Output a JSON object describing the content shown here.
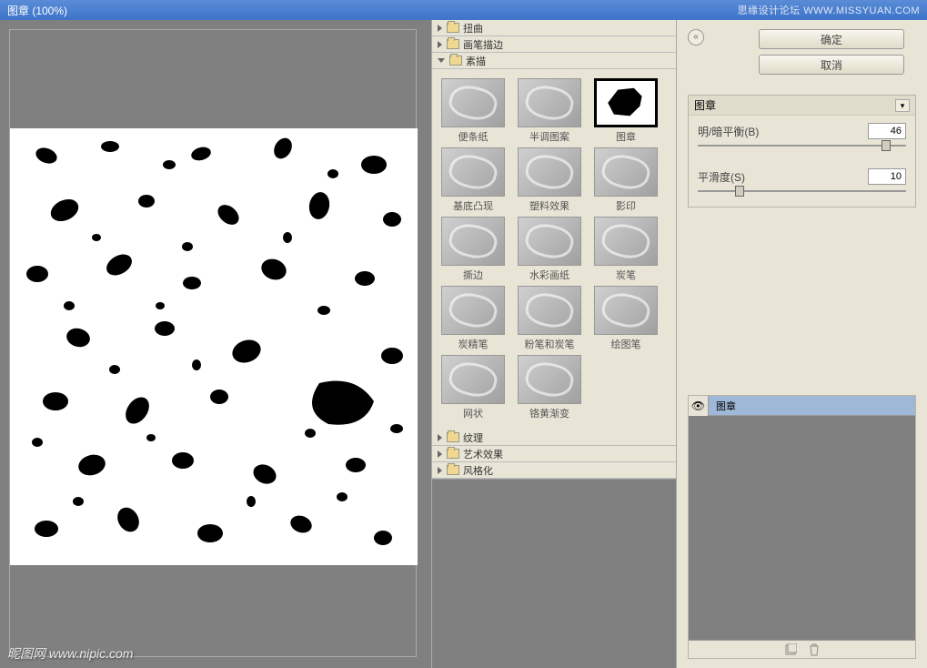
{
  "titlebar": {
    "title": "图章 (100%)",
    "watermark_right": "思缘设计论坛  WWW.MISSYUAN.COM"
  },
  "categories": {
    "c1": "扭曲",
    "c2": "画笔描边",
    "c3": "素描",
    "c4": "纹理",
    "c5": "艺术效果",
    "c6": "风格化"
  },
  "thumbnails": [
    {
      "label": "便条纸"
    },
    {
      "label": "半调图案"
    },
    {
      "label": "图章",
      "selected": true
    },
    {
      "label": "基底凸现"
    },
    {
      "label": "塑料效果"
    },
    {
      "label": "影印"
    },
    {
      "label": "撕边"
    },
    {
      "label": "水彩画纸"
    },
    {
      "label": "炭笔"
    },
    {
      "label": "炭精笔"
    },
    {
      "label": "粉笔和炭笔"
    },
    {
      "label": "绘图笔"
    },
    {
      "label": "网状"
    },
    {
      "label": "铬黄渐变"
    }
  ],
  "buttons": {
    "ok": "确定",
    "cancel": "取消"
  },
  "params": {
    "header": "图章",
    "p1_label": "明/暗平衡(B)",
    "p1_value": "46",
    "p2_label": "平滑度(S)",
    "p2_value": "10"
  },
  "layers": {
    "name": "图章"
  },
  "watermark_bl": "昵图网 www.nipic.com"
}
